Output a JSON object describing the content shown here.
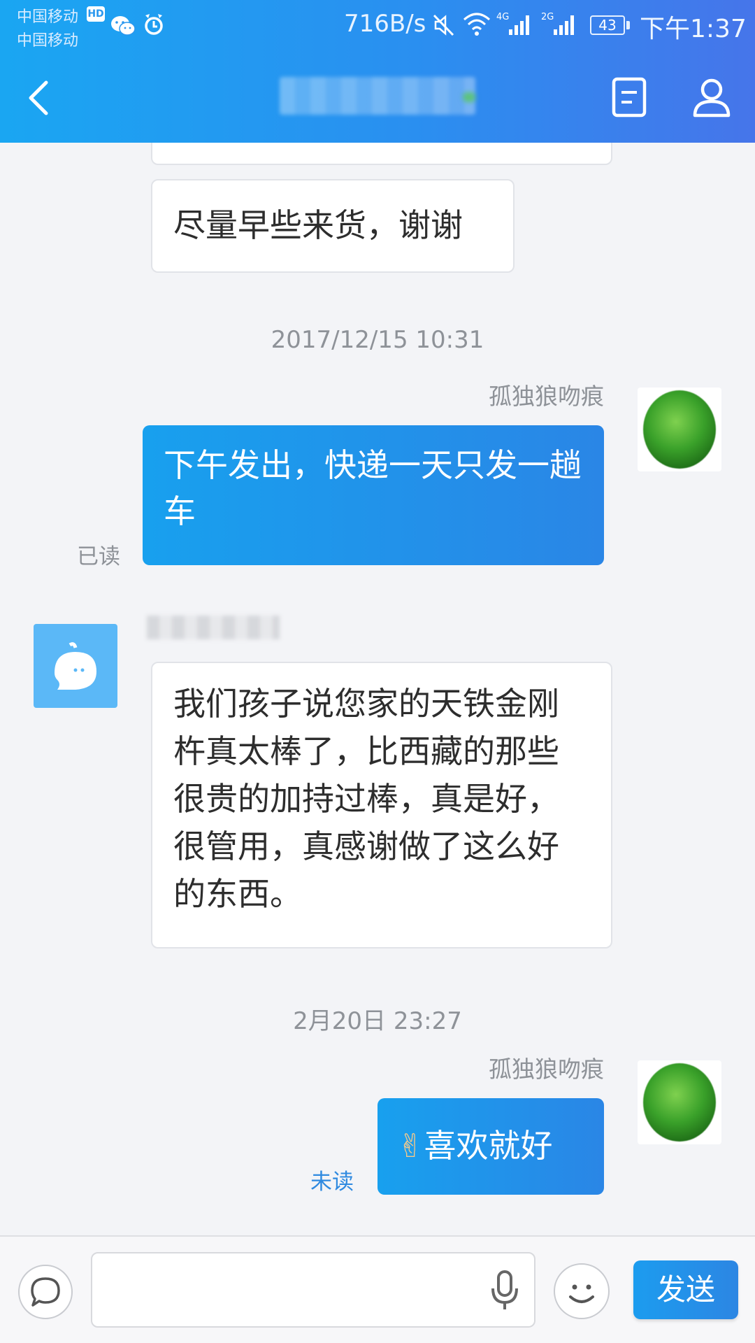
{
  "status_bar": {
    "carrier_1": "中国移动",
    "carrier_2": "中国移动",
    "hd_badge": "HD",
    "net_speed": "716B/s",
    "signal_1_label": "4G",
    "signal_2_label": "2G",
    "battery": "43",
    "time": "下午1:37"
  },
  "header": {
    "back_icon": "chevron-left-icon",
    "title": "",
    "doc_icon": "document-icon",
    "profile_icon": "person-icon",
    "accent_start": "#1aa6f2",
    "accent_end": "#4675ea"
  },
  "messages": {
    "m0_text": "尽量早些来货，谢谢",
    "ts1": "2017/12/15 10:31",
    "m1_sender": "孤独狼吻痕",
    "m1_text": "下午发出，快递一天只发一趟车",
    "m1_status": "已读",
    "m2_text": "我们孩子说您家的天铁金刚杵真太棒了，比西藏的那些很贵的加持过棒，真是好，很管用，真感谢做了这么好的东西。",
    "ts2": "2月20日 23:27",
    "m3_sender": "孤独狼吻痕",
    "m3_emoji": "✌",
    "m3_text": "喜欢就好",
    "m3_status": "未读"
  },
  "input_bar": {
    "placeholder": "",
    "send_label": "发送"
  }
}
